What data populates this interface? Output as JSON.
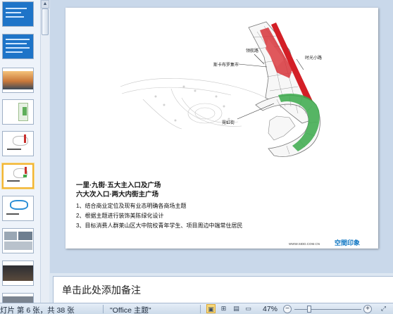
{
  "slide": {
    "labels": {
      "top_building": "领航路",
      "right_road": "时光小路",
      "mid_label": "斯卡布罗集市",
      "bottom_label": "霓虹街"
    },
    "title_lines": [
      "一里·九街·五大主入口及广场",
      "六大次入口·两大内街主广场"
    ],
    "body_lines": [
      "1、结合商业定位及现有业态明确各商场主题",
      "2、根据主题进行装饰美陈绿化设计",
      "3、目标消费人群莱山区大中院校青年学生、项目周边中端常住居民"
    ],
    "website": "WWW.SIDD.COM.CN",
    "logo_text": "空間印象"
  },
  "notes": {
    "placeholder": "单击此处添加备注"
  },
  "status": {
    "slide_info": "灯片 第 6 张，共 38 张",
    "theme": "\"Office 主题\"",
    "zoom": "47%"
  },
  "thumbnails": [
    {
      "index": 1,
      "style": "blue"
    },
    {
      "index": 2,
      "style": "blue"
    },
    {
      "index": 3,
      "style": "photo"
    },
    {
      "index": 4,
      "style": "map"
    },
    {
      "index": 5,
      "style": "plan"
    },
    {
      "index": 6,
      "style": "plan",
      "selected": true
    },
    {
      "index": 7,
      "style": "plan"
    },
    {
      "index": 8,
      "style": "photo"
    },
    {
      "index": 9,
      "style": "photo"
    }
  ]
}
